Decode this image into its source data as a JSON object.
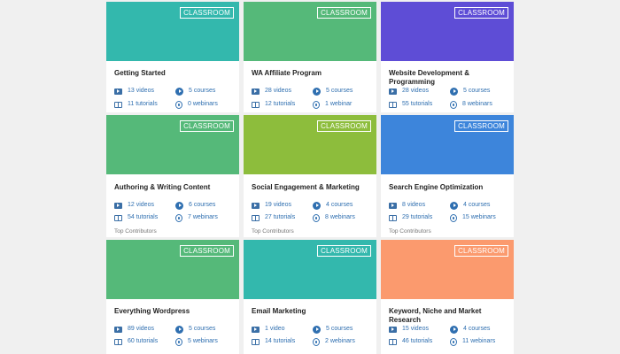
{
  "badge_label": "CLASSROOM",
  "contributors_label": "Top Contributors",
  "colors": {
    "teal": "#33b8ad",
    "green": "#55b979",
    "purple": "#5e4dd6",
    "lime": "#8dbd3c",
    "blue": "#3d85db",
    "orange": "#fb9a6e"
  },
  "cards": [
    {
      "title": "Getting Started",
      "videos": "13 videos",
      "courses": "5 courses",
      "tutorials": "11 tutorials",
      "webinars": "0 webinars",
      "color": "teal"
    },
    {
      "title": "WA Affiliate Program",
      "videos": "28 videos",
      "courses": "5 courses",
      "tutorials": "12 tutorials",
      "webinars": "1 webinar",
      "color": "green"
    },
    {
      "title": "Website Development & Programming",
      "videos": "28 videos",
      "courses": "5 courses",
      "tutorials": "55 tutorials",
      "webinars": "8 webinars",
      "color": "purple"
    },
    {
      "title": "Authoring & Writing Content",
      "videos": "12 videos",
      "courses": "6 courses",
      "tutorials": "54 tutorials",
      "webinars": "7 webinars",
      "color": "green"
    },
    {
      "title": "Social Engagement & Marketing",
      "videos": "19 videos",
      "courses": "4 courses",
      "tutorials": "27 tutorials",
      "webinars": "8 webinars",
      "color": "lime"
    },
    {
      "title": "Search Engine Optimization",
      "videos": "8 videos",
      "courses": "4 courses",
      "tutorials": "29 tutorials",
      "webinars": "15 webinars",
      "color": "blue"
    },
    {
      "title": "Everything Wordpress",
      "videos": "89 videos",
      "courses": "5 courses",
      "tutorials": "60 tutorials",
      "webinars": "5 webinars",
      "color": "green"
    },
    {
      "title": "Email Marketing",
      "videos": "1 video",
      "courses": "5 courses",
      "tutorials": "14 tutorials",
      "webinars": "2 webinars",
      "color": "teal"
    },
    {
      "title": "Keyword, Niche and Market Research",
      "videos": "15 videos",
      "courses": "4 courses",
      "tutorials": "46 tutorials",
      "webinars": "11 webinars",
      "color": "orange"
    }
  ]
}
